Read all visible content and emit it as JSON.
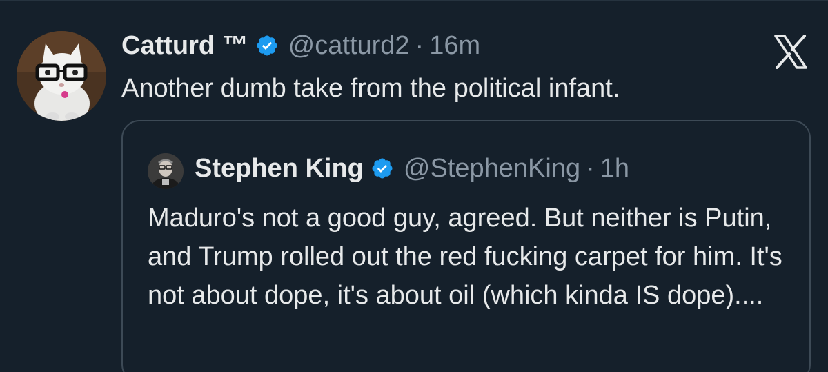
{
  "tweet": {
    "author": {
      "name": "Catturd ™",
      "handle": "@catturd2",
      "time": "16m",
      "separator": "·"
    },
    "text": "Another dumb take from the political infant.",
    "quoted": {
      "author": {
        "name": "Stephen King",
        "handle": "@StephenKing",
        "time": "1h",
        "separator": "·"
      },
      "text": "Maduro's not a good guy, agreed. But neither is Putin, and Trump rolled out the red fucking carpet for him. It's not about dope, it's about oil (which kinda IS dope)...."
    }
  },
  "icons": {
    "verified": "verified-badge-icon",
    "platform": "x-logo-icon"
  },
  "colors": {
    "background": "#15202b",
    "text": "#e7e9ea",
    "muted": "#8b98a5",
    "verified": "#1d9bf0",
    "border": "#3d4a56"
  }
}
